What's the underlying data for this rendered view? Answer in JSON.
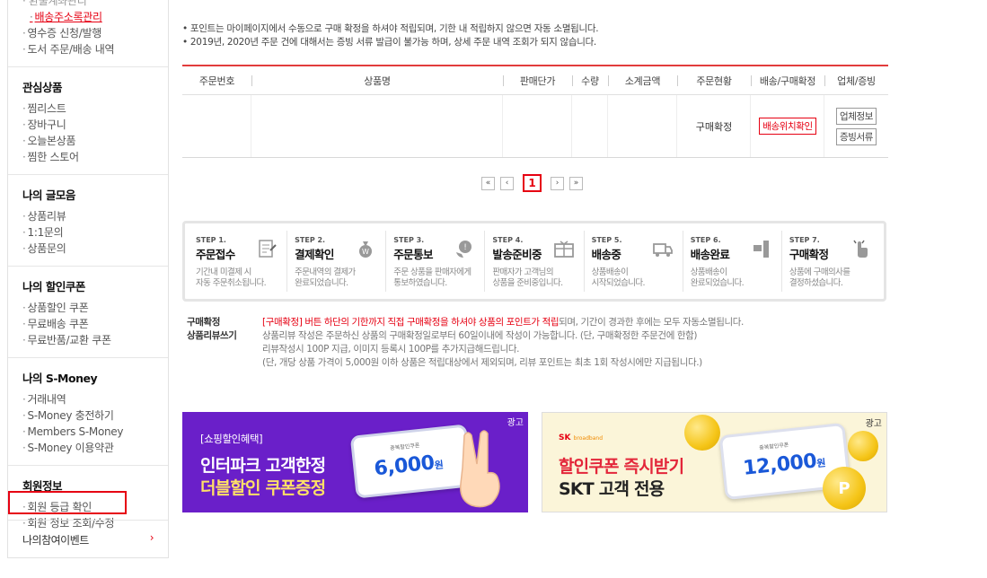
{
  "sidebar": {
    "top_items": [
      "환불계좌관리",
      "배송주소록관리",
      "영수증 신청/발행",
      "도서 주문/배송 내역"
    ],
    "sections": [
      {
        "title": "관심상품",
        "items": [
          "찜리스트",
          "장바구니",
          "오늘본상품",
          "찜한 스토어"
        ]
      },
      {
        "title": "나의 글모음",
        "items": [
          "상품리뷰",
          "1:1문의",
          "상품문의"
        ]
      },
      {
        "title": "나의 할인쿠폰",
        "items": [
          "상품할인 쿠폰",
          "무료배송 쿠폰",
          "무료반품/교환 쿠폰"
        ]
      },
      {
        "title": "나의 S-Money",
        "items": [
          "거래내역",
          "S-Money 충전하기",
          "Members S-Money",
          "S-Money 이용약관"
        ]
      },
      {
        "title": "회원정보",
        "items": [
          "회원 등급 확인",
          "회원 정보 조회/수정"
        ]
      }
    ],
    "event": {
      "label": "나의참여이벤트",
      "chevron": "›"
    }
  },
  "notice": [
    "• 포인트는 마이페이지에서 수동으로 구매 확정을 하셔야 적립되며, 기한 내 적립하지 않으면 자동 소멸됩니다.",
    "• 2019년, 2020년 주문 건에 대해서는 증빙 서류 발급이 불가능 하며, 상세 주문 내역 조회가 되지 않습니다."
  ],
  "table": {
    "headers": [
      "주문번호",
      "상품명",
      "판매단가",
      "수량",
      "소계금액",
      "주문현황",
      "배송/구매확정",
      "업체/증빙"
    ],
    "row": {
      "status": "구매확정",
      "track_btn": "배송위치확인",
      "vendor_btn": "업체정보",
      "proof_btn": "증빙서류"
    }
  },
  "pagination": {
    "first": "«",
    "prev": "‹",
    "current": "1",
    "next": "›",
    "last": "»"
  },
  "steps": [
    {
      "no": "STEP 1.",
      "title": "주문접수",
      "desc": [
        "기간내 미결제 시",
        "자동 주문취소됩니다."
      ],
      "icon": "form-icon"
    },
    {
      "no": "STEP 2.",
      "title": "결제확인",
      "desc": [
        "주문내역의 결제가",
        "완료되었습니다."
      ],
      "icon": "money-bag-icon"
    },
    {
      "no": "STEP 3.",
      "title": "주문통보",
      "desc": [
        "주문 상품을 판매자에게",
        "통보하였습니다."
      ],
      "icon": "phone-icon"
    },
    {
      "no": "STEP 4.",
      "title": "발송준비중",
      "desc": [
        "판매자가 고객님의",
        "상품을 준비중입니다."
      ],
      "icon": "box-icon"
    },
    {
      "no": "STEP 5.",
      "title": "배송중",
      "desc": [
        "상품배송이",
        "시작되었습니다."
      ],
      "icon": "truck-icon"
    },
    {
      "no": "STEP 6.",
      "title": "배송완료",
      "desc": [
        "상품배송이",
        "완료되었습니다."
      ],
      "icon": "delivery-icon"
    },
    {
      "no": "STEP 7.",
      "title": "구매확정",
      "desc": [
        "상품에 구매의사를",
        "결정하셨습니다."
      ],
      "icon": "hand-click-icon"
    }
  ],
  "info": {
    "label1": "구매확정",
    "label2": "상품리뷰쓰기",
    "line1_red": "[구매확정] 버튼 하단의 기한까지 직접 구매확정을 하셔야 상품의 포인트가 적립",
    "line1_rest": "되며, 기간이 경과한 후에는 모두 자동소멸됩니다.",
    "line2": "상품리뷰 작성은 주문하신 상품의 구매확정일로부터 60일이내에 작성이 가능합니다. (단, 구매확정한 주문건에 한함)",
    "line3": "리뷰작성시 100P 지급, 이미지 등록시 100P를 추가지급해드립니다.",
    "line4": "(단, 개당 상품 가격이 5,000원 이하 상품은 적립대상에서 제외되며, 리뷰 포인트는 최초 1회 작성시에만 지급됩니다.)"
  },
  "ads": [
    {
      "tag": "광고",
      "badge": "[쇼핑할인혜택]",
      "line1": "인터파크 고객한정",
      "line2": "더블할인 쿠폰증정",
      "coupon_title": "중복할인쿠폰",
      "amount": "6,000",
      "unit": "원"
    },
    {
      "tag": "광고",
      "brand": "SK",
      "brand_sub": "broadband",
      "line1": "할인쿠폰 즉시받기",
      "line2": "SKT 고객 전용",
      "coupon_title": "중복할인쿠폰",
      "amount": "12,000",
      "unit": "원",
      "coin_label": "P"
    }
  ],
  "colors": {
    "accent": "#e60012",
    "ad1_bg": "#6a1fc9",
    "ad2_bg": "#fbf5d9"
  }
}
